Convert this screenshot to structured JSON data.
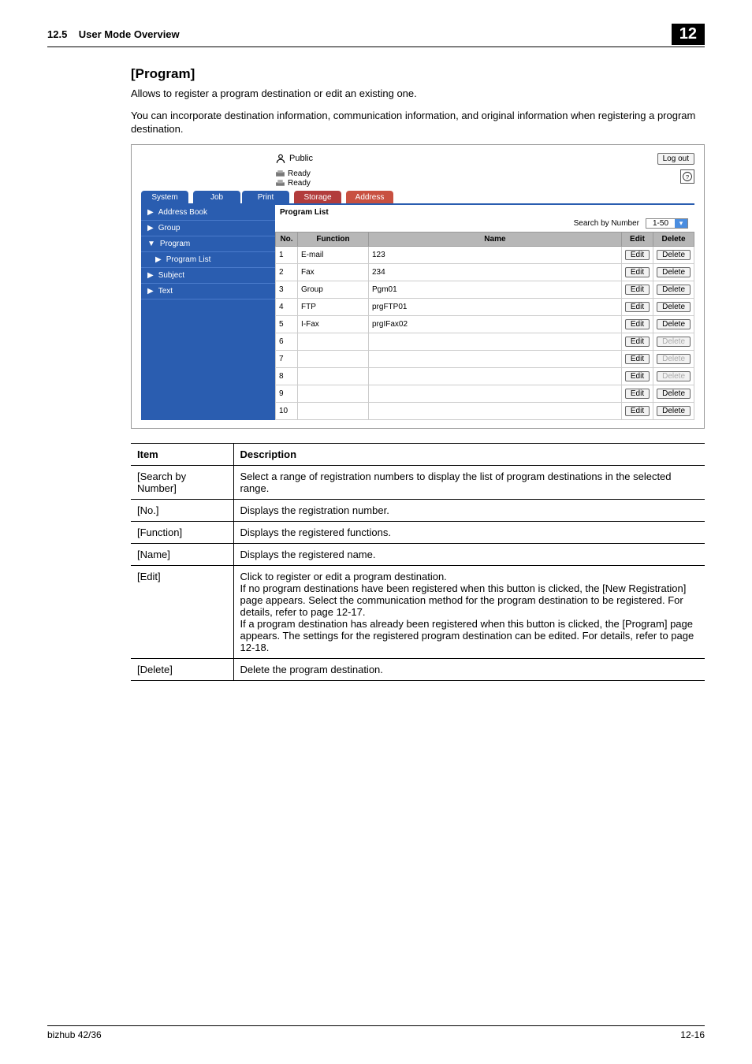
{
  "header": {
    "section": "12.5",
    "title": "User Mode Overview",
    "chapter": "12"
  },
  "section_title": "[Program]",
  "para1": "Allows to register a program destination or edit an existing one.",
  "para2": "You can incorporate destination information, communication information, and original information when registering a program destination.",
  "ui": {
    "public_label": "Public",
    "logout": "Log out",
    "ready1": "Ready",
    "ready2": "Ready",
    "tabs": {
      "system": "System",
      "job": "Job",
      "print": "Print",
      "storage": "Storage",
      "address": "Address"
    },
    "sidebar": {
      "addr": "Address Book",
      "group": "Group",
      "program": "Program",
      "program_list": "Program List",
      "subject": "Subject",
      "text": "Text"
    },
    "main_title": "Program List",
    "search_label": "Search by Number",
    "search_value": "1-50",
    "columns": {
      "no": "No.",
      "func": "Function",
      "name": "Name",
      "edit": "Edit",
      "del": "Delete"
    },
    "rows": [
      {
        "no": "1",
        "func": "E-mail",
        "name": "123",
        "hasDelete": true
      },
      {
        "no": "2",
        "func": "Fax",
        "name": "234",
        "hasDelete": true
      },
      {
        "no": "3",
        "func": "Group",
        "name": "Pgm01",
        "hasDelete": true
      },
      {
        "no": "4",
        "func": "FTP",
        "name": "prgFTP01",
        "hasDelete": true
      },
      {
        "no": "5",
        "func": "I-Fax",
        "name": "prgIFax02",
        "hasDelete": true
      },
      {
        "no": "6",
        "func": "",
        "name": "",
        "hasDelete": false
      },
      {
        "no": "7",
        "func": "",
        "name": "",
        "hasDelete": false
      },
      {
        "no": "8",
        "func": "",
        "name": "",
        "hasDelete": false
      },
      {
        "no": "9",
        "func": "",
        "name": "",
        "hasDelete": true
      },
      {
        "no": "10",
        "func": "",
        "name": "",
        "hasDelete": true
      }
    ],
    "edit_btn": "Edit",
    "delete_btn": "Delete"
  },
  "desc_table": {
    "head_item": "Item",
    "head_desc": "Description",
    "rows": [
      {
        "item": "[Search by Number]",
        "desc": "Select a range of registration numbers to display the list of program destinations in the selected range."
      },
      {
        "item": "[No.]",
        "desc": "Displays the registration number."
      },
      {
        "item": "[Function]",
        "desc": "Displays the registered functions."
      },
      {
        "item": "[Name]",
        "desc": "Displays the registered name."
      },
      {
        "item": "[Edit]",
        "desc": "Click to register or edit a program destination.\nIf no program destinations have been registered when this button is clicked, the [New Registration] page appears. Select the communication method for the program destination to be registered. For details, refer to page 12-17.\nIf a program destination has already been registered when this button is clicked, the [Program] page appears. The settings for the registered program destination can be edited. For details, refer to page 12-18."
      },
      {
        "item": "[Delete]",
        "desc": "Delete the program destination."
      }
    ]
  },
  "footer": {
    "left": "bizhub 42/36",
    "right": "12-16"
  }
}
